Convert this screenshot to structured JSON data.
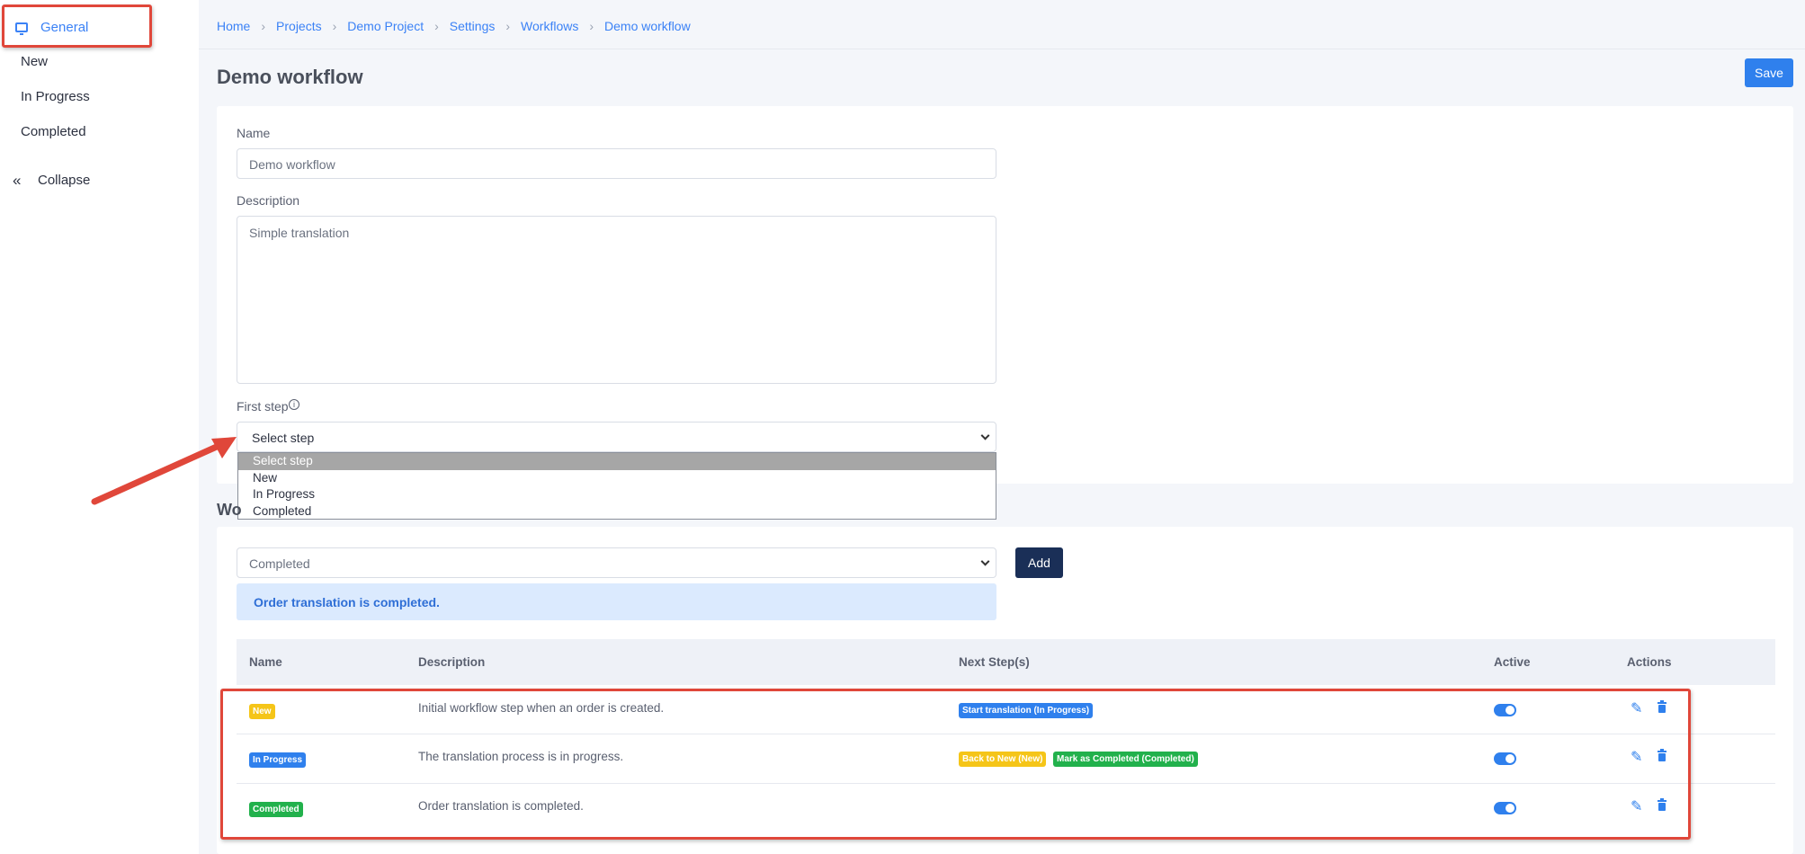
{
  "sidebar": {
    "active_label": "General",
    "items": [
      {
        "label": "New"
      },
      {
        "label": "In Progress"
      },
      {
        "label": "Completed"
      }
    ],
    "collapse_icon": "«",
    "collapse_label": "Collapse"
  },
  "breadcrumb": [
    "Home",
    "Projects",
    "Demo Project",
    "Settings",
    "Workflows",
    "Demo workflow"
  ],
  "page_title": "Demo workflow",
  "save_label": "Save",
  "form": {
    "name_label": "Name",
    "name_value": "Demo workflow",
    "description_label": "Description",
    "description_value": "Simple translation",
    "first_step_label": "First step",
    "first_step_value": "Select step",
    "first_step_options": [
      "Select step",
      "New",
      "In Progress",
      "Completed"
    ]
  },
  "steps_section_title_fragment": "Wo",
  "steps": {
    "step_select_value": "Completed",
    "add_label": "Add",
    "info_text": "Order translation is completed.",
    "columns": [
      "Name",
      "Description",
      "Next Step(s)",
      "Active",
      "Actions"
    ],
    "rows": [
      {
        "name": "New",
        "name_color": "#f5c518",
        "description": "Initial workflow step when an order is created.",
        "next_steps": [
          {
            "label": "Start translation (In Progress)",
            "color": "#2f80ed"
          }
        ],
        "active": true
      },
      {
        "name": "In Progress",
        "name_color": "#2f80ed",
        "description": "The translation process is in progress.",
        "next_steps": [
          {
            "label": "Back to New (New)",
            "color": "#f5c518"
          },
          {
            "label": "Mark as Completed (Completed)",
            "color": "#22b14c"
          }
        ],
        "active": true
      },
      {
        "name": "Completed",
        "name_color": "#22b14c",
        "description": "Order translation is completed.",
        "next_steps": [],
        "active": true
      }
    ]
  },
  "icons": {
    "general": "monitor-icon",
    "info": "info-icon",
    "edit": "pencil-icon",
    "delete": "trash-icon",
    "chevron": "chevron-down-icon"
  },
  "colors": {
    "accent": "#2f80ed",
    "highlight": "#e0473a",
    "dark_button": "#1a2f57"
  }
}
